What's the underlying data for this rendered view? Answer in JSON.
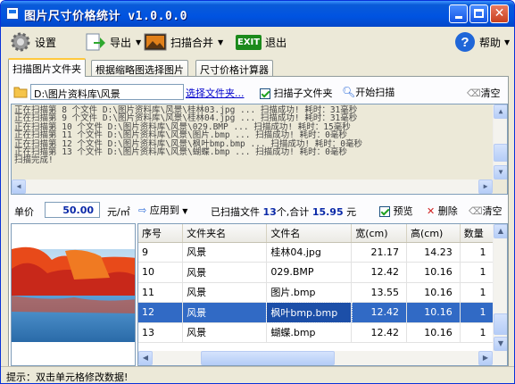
{
  "window": {
    "title": "图片尺寸价格统计 v1.0.0.0"
  },
  "toolbar": {
    "settings": "设置",
    "export": "导出",
    "scan_merge": "扫描合并",
    "exit_icon_text": "EXIT",
    "exit": "退出",
    "help": "帮助"
  },
  "tabs": [
    "扫描图片文件夹",
    "根据缩略图选择图片",
    "尺寸价格计算器"
  ],
  "scan": {
    "path": "D:\\图片资料库\\风景",
    "select_folder": "选择文件夹...",
    "include_subfolders": "扫描子文件夹",
    "start_scan": "开始扫描",
    "clear": "清空"
  },
  "log_lines": [
    "正在扫描第 8 个文件 D:\\图片资料库\\风景\\桂林03.jpg ... 扫描成功! 耗时：31毫秒",
    "正在扫描第 9 个文件 D:\\图片资料库\\风景\\桂林04.jpg ... 扫描成功! 耗时：31毫秒",
    "正在扫描第 10 个文件 D:\\图片资料库\\风景\\029.BMP ... 扫描成功! 耗时：15毫秒",
    "正在扫描第 11 个文件 D:\\图片资料库\\风景\\图片.bmp ... 扫描成功! 耗时：0毫秒",
    "正在扫描第 12 个文件 D:\\图片资料库\\风景\\枫叶bmp.bmp ... 扫描成功! 耗时：0毫秒",
    "正在扫描第 13 个文件 D:\\图片资料库\\风景\\蝴蝶.bmp ... 扫描成功! 耗时：0毫秒",
    "扫描完成!"
  ],
  "price": {
    "label": "单价",
    "value": "50.00",
    "unit": "元/㎡",
    "apply_to": "应用到",
    "summary_prefix": "已扫描文件",
    "count": "13",
    "summary_mid": "个,合计",
    "total": "15.95",
    "summary_suffix": "元",
    "preview": "预览",
    "delete": "删除",
    "clear": "清空"
  },
  "table": {
    "headers": [
      "序号",
      "文件夹名",
      "文件名",
      "宽(cm)",
      "高(cm)",
      "数量"
    ],
    "rows": [
      [
        "9",
        "风景",
        "桂林04.jpg",
        "21.17",
        "14.23",
        "1"
      ],
      [
        "10",
        "风景",
        "029.BMP",
        "12.42",
        "10.16",
        "1"
      ],
      [
        "11",
        "风景",
        "图片.bmp",
        "13.55",
        "10.16",
        "1"
      ],
      [
        "12",
        "风景",
        "枫叶bmp.bmp",
        "12.42",
        "10.16",
        "1"
      ],
      [
        "13",
        "风景",
        "蝴蝶.bmp",
        "12.42",
        "10.16",
        "1"
      ]
    ],
    "selected_row": 3
  },
  "status": {
    "hint": "提示：双击单元格修改数据!"
  },
  "colors": {
    "accent": "#316ac5",
    "title_bar": "#0053e1",
    "value_blue": "#0b2aa8"
  }
}
